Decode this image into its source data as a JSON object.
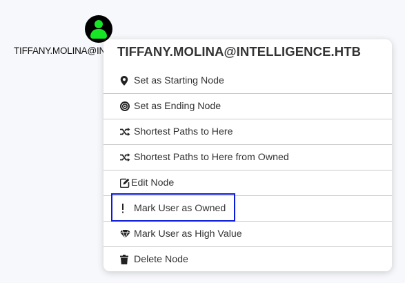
{
  "node": {
    "icon": "user-icon",
    "label": "TIFFANY.MOLINA@INTELLIGENCE.HTB",
    "icon_color": "#17e625"
  },
  "menu": {
    "title": "TIFFANY.MOLINA@INTELLIGENCE.HTB",
    "items": [
      {
        "label": "Set as Starting Node",
        "icon": "map-marker-icon"
      },
      {
        "label": "Set as Ending Node",
        "icon": "bullseye-icon"
      },
      {
        "label": "Shortest Paths to Here",
        "icon": "random-icon"
      },
      {
        "label": "Shortest Paths to Here from Owned",
        "icon": "random-icon"
      },
      {
        "label": "Edit Node",
        "icon": "edit-icon"
      },
      {
        "label": "Mark User as Owned",
        "icon": "exclamation-icon"
      },
      {
        "label": "Mark User as High Value",
        "icon": "gem-icon"
      },
      {
        "label": "Delete Node",
        "icon": "trash-icon"
      }
    ]
  },
  "highlight_color": "#0b1ad6"
}
